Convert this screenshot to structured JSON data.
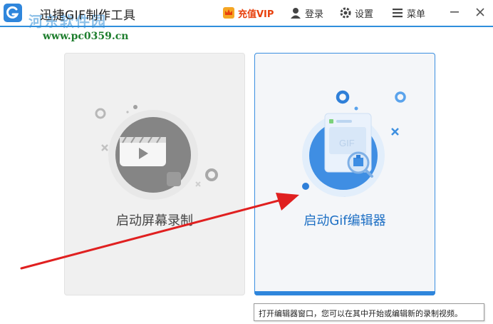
{
  "window": {
    "title": "迅捷GIF制作工具",
    "icon": "app-logo-icon"
  },
  "watermark": {
    "name": "河东软件园",
    "url": "www.pc0359.cn"
  },
  "toolbar": {
    "vip_label": "充值VIP",
    "vip_icon": "crown-icon",
    "login_label": "登录",
    "login_icon": "user-icon",
    "settings_label": "设置",
    "settings_icon": "gear-icon",
    "menu_label": "菜单",
    "menu_icon": "hamburger-icon",
    "minimize_icon": "minimize-icon",
    "close_icon": "close-icon"
  },
  "cards": {
    "record": {
      "label": "启动屏幕录制",
      "icon": "video-camera-icon",
      "state": "inactive"
    },
    "gif": {
      "label": "启动Gif编辑器",
      "icon": "gif-editor-icon",
      "state": "selected"
    }
  },
  "tooltip": {
    "text": "打开编辑器窗口，您可以在其中开始或编辑新的录制视频。"
  },
  "colors": {
    "accent": "#2f86dc",
    "vip": "#e8400c",
    "annotation_arrow": "#e02020"
  }
}
